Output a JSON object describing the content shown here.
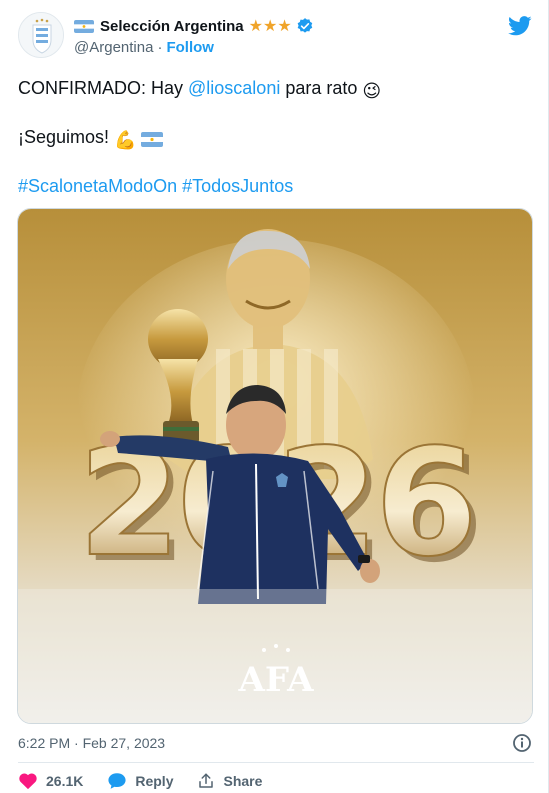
{
  "header": {
    "display_name": "Selección Argentina",
    "stars": "★★★",
    "handle": "@Argentina",
    "separator": "·",
    "follow_label": "Follow",
    "icons": [
      "argentina-flag-icon",
      "verified-badge-icon",
      "twitter-bird-icon"
    ]
  },
  "body": {
    "line1_prefix": "CONFIRMADO: Hay ",
    "line1_mention": "@lioscaloni",
    "line1_suffix": " para rato ",
    "line1_emoji": "😉",
    "line2_text": "¡Seguimos! ",
    "line2_emoji": "💪",
    "hashtag1": "#ScalonetaModoOn",
    "hashtag2": "#TodosJuntos"
  },
  "media": {
    "big_number": "2026",
    "logo_text": "AFA",
    "alt": "image"
  },
  "footer": {
    "timestamp": "6:22 PM · Feb 27, 2023",
    "likes": "26.1K",
    "reply_label": "Reply",
    "share_label": "Share"
  },
  "colors": {
    "accent": "#1d9bf0",
    "like": "#f91880",
    "stars": "#f0a42a",
    "muted": "#536471"
  }
}
